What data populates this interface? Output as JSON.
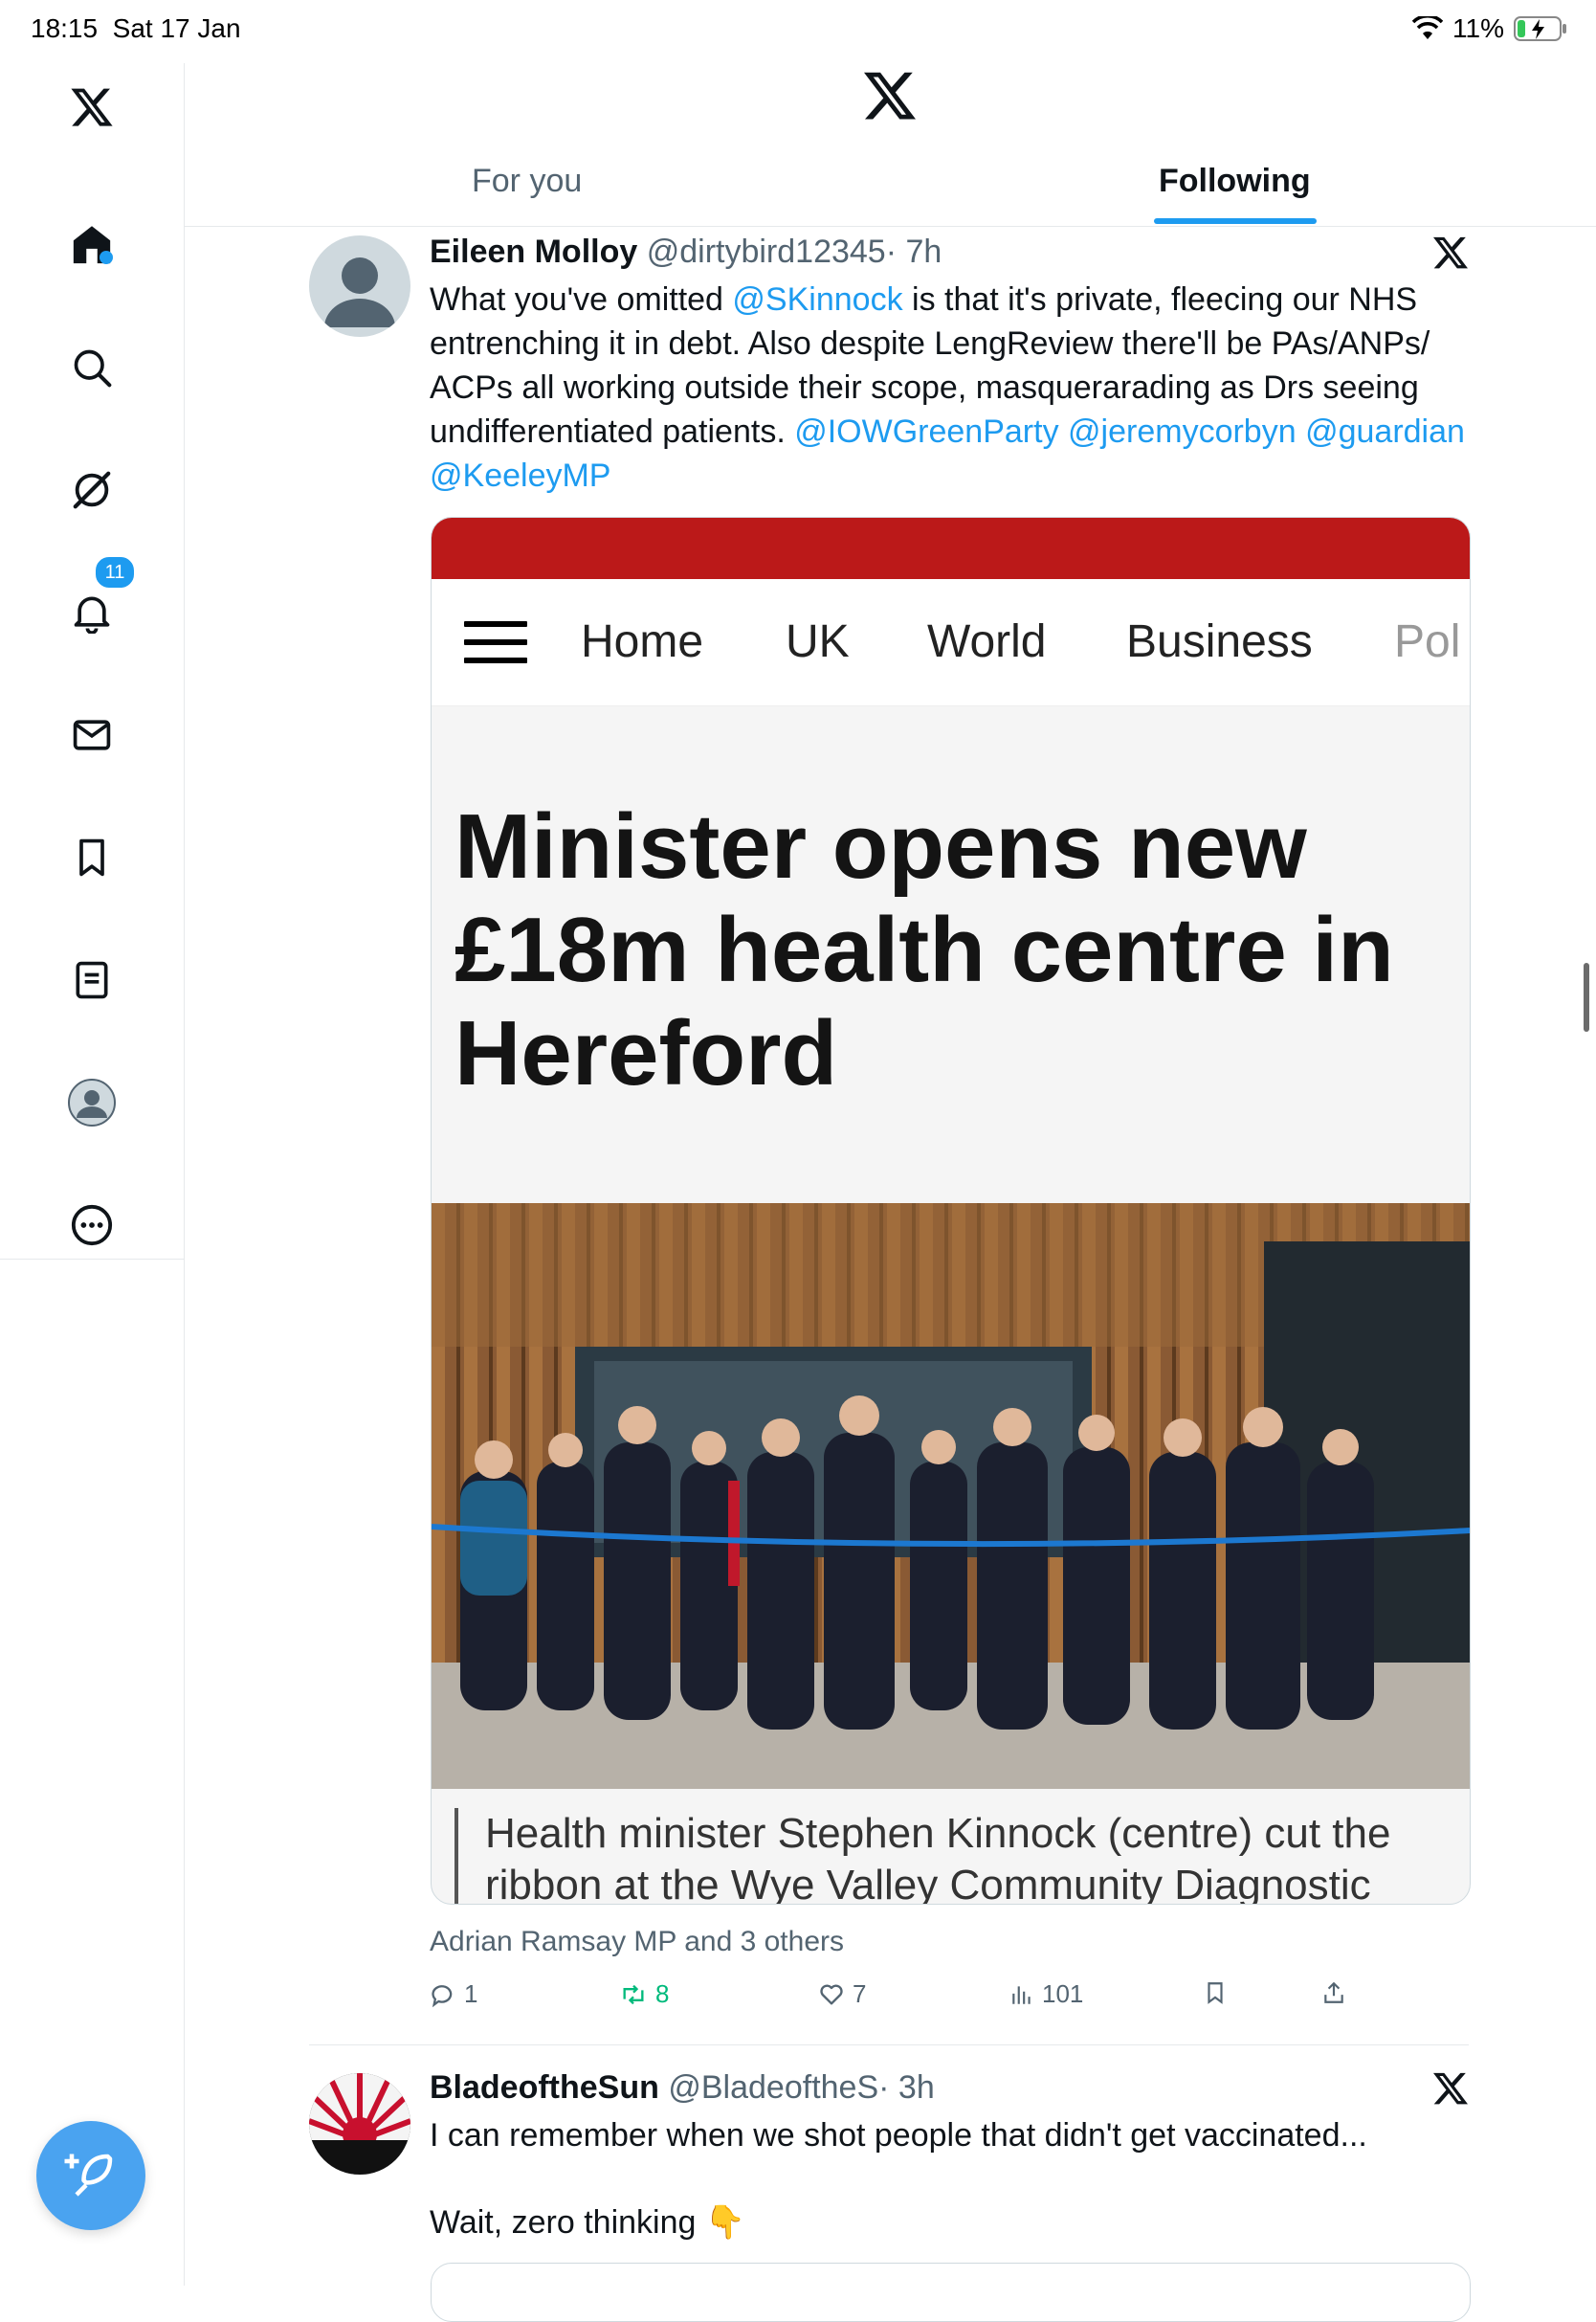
{
  "status_bar": {
    "time": "18:15",
    "date": "Sat 17 Jan",
    "battery": "11%"
  },
  "sidebar": {
    "notification_count": "11"
  },
  "tabs": [
    {
      "label": "For you"
    },
    {
      "label": "Following"
    }
  ],
  "tweet1": {
    "author": "Eileen Molloy",
    "handle": "@dirtybird12345",
    "time": "· 7h",
    "text_a": "What you've omitted ",
    "mention1": "@SKinnock",
    "text_b": " is that it's private, fleecing our NHS entrenching it in debt. Also despite LengReview there'll be PAs/ANPs/ ACPs all working outside their scope, masquerarading as Drs seeing undifferentiated patients. ",
    "mention2": "@IOWGreenParty",
    "mention3": "@jeremycorbyn",
    "mention4": "@guardian",
    "mention5": "@KeeleyMP",
    "card": {
      "nav": [
        "Home",
        "UK",
        "World",
        "Business",
        "Pol"
      ],
      "headline": "Minister opens new £18m health centre in Hereford",
      "caption": "Health minister Stephen Kinnock (centre) cut the ribbon at the Wye Valley Community Diagnostic"
    },
    "liked_by": "Adrian Ramsay MP and 3 others",
    "replies": "1",
    "retweets": "8",
    "likes": "7",
    "views": "101"
  },
  "tweet2": {
    "author": "BladeoftheSun",
    "handle": "@BladeoftheS",
    "time": "· 3h",
    "text": "I can remember when we shot people that didn't get vaccinated...",
    "text2": "Wait, zero thinking 👇"
  },
  "colors": {
    "accent": "#1d9bf0",
    "retweet": "#00ba7c",
    "bbc_red": "#bb1919"
  }
}
